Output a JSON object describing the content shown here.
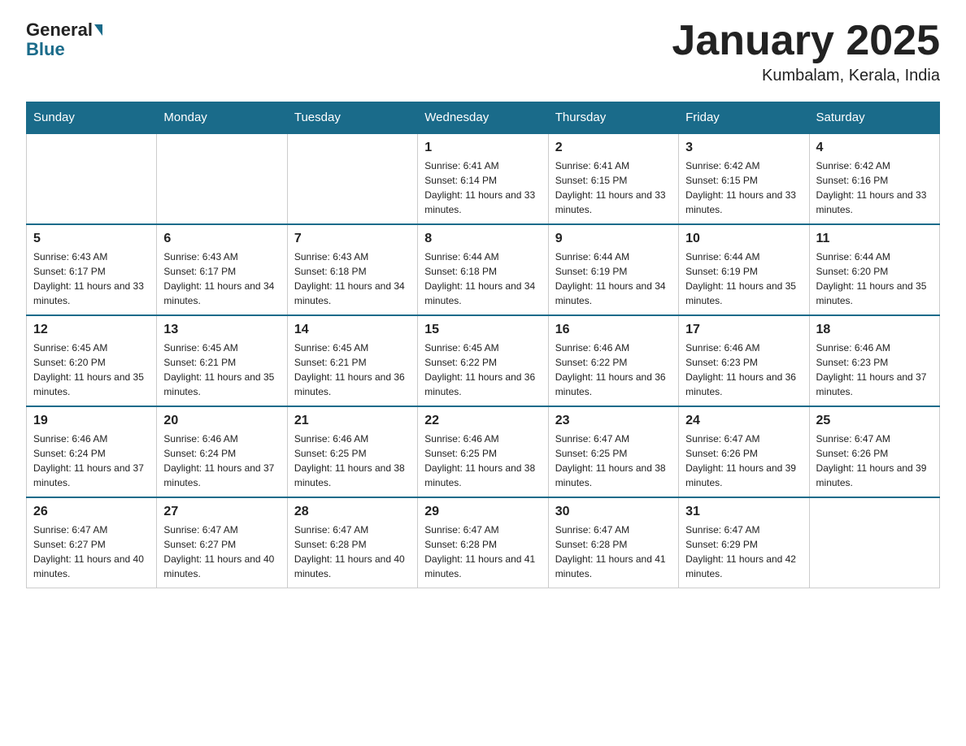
{
  "header": {
    "logo_general": "General",
    "logo_blue": "Blue",
    "month_title": "January 2025",
    "location": "Kumbalam, Kerala, India"
  },
  "days_of_week": [
    "Sunday",
    "Monday",
    "Tuesday",
    "Wednesday",
    "Thursday",
    "Friday",
    "Saturday"
  ],
  "weeks": [
    [
      {
        "day": "",
        "info": ""
      },
      {
        "day": "",
        "info": ""
      },
      {
        "day": "",
        "info": ""
      },
      {
        "day": "1",
        "info": "Sunrise: 6:41 AM\nSunset: 6:14 PM\nDaylight: 11 hours and 33 minutes."
      },
      {
        "day": "2",
        "info": "Sunrise: 6:41 AM\nSunset: 6:15 PM\nDaylight: 11 hours and 33 minutes."
      },
      {
        "day": "3",
        "info": "Sunrise: 6:42 AM\nSunset: 6:15 PM\nDaylight: 11 hours and 33 minutes."
      },
      {
        "day": "4",
        "info": "Sunrise: 6:42 AM\nSunset: 6:16 PM\nDaylight: 11 hours and 33 minutes."
      }
    ],
    [
      {
        "day": "5",
        "info": "Sunrise: 6:43 AM\nSunset: 6:17 PM\nDaylight: 11 hours and 33 minutes."
      },
      {
        "day": "6",
        "info": "Sunrise: 6:43 AM\nSunset: 6:17 PM\nDaylight: 11 hours and 34 minutes."
      },
      {
        "day": "7",
        "info": "Sunrise: 6:43 AM\nSunset: 6:18 PM\nDaylight: 11 hours and 34 minutes."
      },
      {
        "day": "8",
        "info": "Sunrise: 6:44 AM\nSunset: 6:18 PM\nDaylight: 11 hours and 34 minutes."
      },
      {
        "day": "9",
        "info": "Sunrise: 6:44 AM\nSunset: 6:19 PM\nDaylight: 11 hours and 34 minutes."
      },
      {
        "day": "10",
        "info": "Sunrise: 6:44 AM\nSunset: 6:19 PM\nDaylight: 11 hours and 35 minutes."
      },
      {
        "day": "11",
        "info": "Sunrise: 6:44 AM\nSunset: 6:20 PM\nDaylight: 11 hours and 35 minutes."
      }
    ],
    [
      {
        "day": "12",
        "info": "Sunrise: 6:45 AM\nSunset: 6:20 PM\nDaylight: 11 hours and 35 minutes."
      },
      {
        "day": "13",
        "info": "Sunrise: 6:45 AM\nSunset: 6:21 PM\nDaylight: 11 hours and 35 minutes."
      },
      {
        "day": "14",
        "info": "Sunrise: 6:45 AM\nSunset: 6:21 PM\nDaylight: 11 hours and 36 minutes."
      },
      {
        "day": "15",
        "info": "Sunrise: 6:45 AM\nSunset: 6:22 PM\nDaylight: 11 hours and 36 minutes."
      },
      {
        "day": "16",
        "info": "Sunrise: 6:46 AM\nSunset: 6:22 PM\nDaylight: 11 hours and 36 minutes."
      },
      {
        "day": "17",
        "info": "Sunrise: 6:46 AM\nSunset: 6:23 PM\nDaylight: 11 hours and 36 minutes."
      },
      {
        "day": "18",
        "info": "Sunrise: 6:46 AM\nSunset: 6:23 PM\nDaylight: 11 hours and 37 minutes."
      }
    ],
    [
      {
        "day": "19",
        "info": "Sunrise: 6:46 AM\nSunset: 6:24 PM\nDaylight: 11 hours and 37 minutes."
      },
      {
        "day": "20",
        "info": "Sunrise: 6:46 AM\nSunset: 6:24 PM\nDaylight: 11 hours and 37 minutes."
      },
      {
        "day": "21",
        "info": "Sunrise: 6:46 AM\nSunset: 6:25 PM\nDaylight: 11 hours and 38 minutes."
      },
      {
        "day": "22",
        "info": "Sunrise: 6:46 AM\nSunset: 6:25 PM\nDaylight: 11 hours and 38 minutes."
      },
      {
        "day": "23",
        "info": "Sunrise: 6:47 AM\nSunset: 6:25 PM\nDaylight: 11 hours and 38 minutes."
      },
      {
        "day": "24",
        "info": "Sunrise: 6:47 AM\nSunset: 6:26 PM\nDaylight: 11 hours and 39 minutes."
      },
      {
        "day": "25",
        "info": "Sunrise: 6:47 AM\nSunset: 6:26 PM\nDaylight: 11 hours and 39 minutes."
      }
    ],
    [
      {
        "day": "26",
        "info": "Sunrise: 6:47 AM\nSunset: 6:27 PM\nDaylight: 11 hours and 40 minutes."
      },
      {
        "day": "27",
        "info": "Sunrise: 6:47 AM\nSunset: 6:27 PM\nDaylight: 11 hours and 40 minutes."
      },
      {
        "day": "28",
        "info": "Sunrise: 6:47 AM\nSunset: 6:28 PM\nDaylight: 11 hours and 40 minutes."
      },
      {
        "day": "29",
        "info": "Sunrise: 6:47 AM\nSunset: 6:28 PM\nDaylight: 11 hours and 41 minutes."
      },
      {
        "day": "30",
        "info": "Sunrise: 6:47 AM\nSunset: 6:28 PM\nDaylight: 11 hours and 41 minutes."
      },
      {
        "day": "31",
        "info": "Sunrise: 6:47 AM\nSunset: 6:29 PM\nDaylight: 11 hours and 42 minutes."
      },
      {
        "day": "",
        "info": ""
      }
    ]
  ]
}
